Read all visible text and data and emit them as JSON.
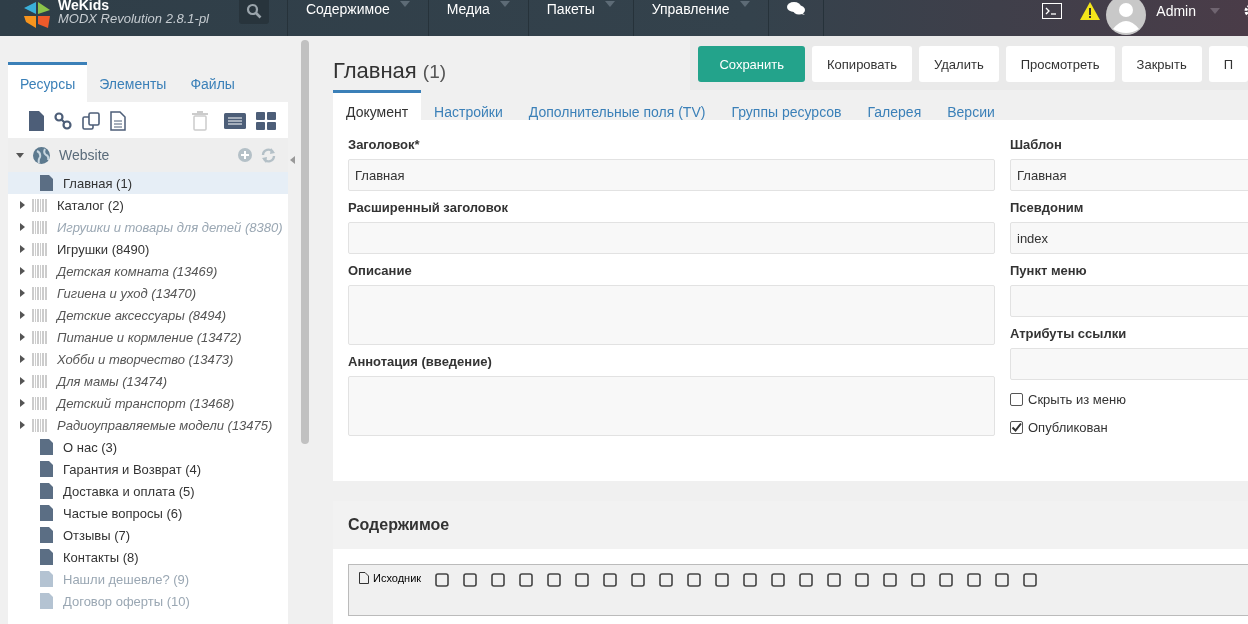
{
  "header": {
    "brand": "WeKids",
    "version": "MODX Revolution 2.8.1-pl",
    "menu": [
      {
        "label": "Содержимое"
      },
      {
        "label": "Медиа"
      },
      {
        "label": "Пакеты"
      },
      {
        "label": "Управление"
      }
    ],
    "user": "Admin"
  },
  "sidebar": {
    "tabs": [
      {
        "label": "Ресурсы",
        "selected": true
      },
      {
        "label": "Элементы",
        "selected": false
      },
      {
        "label": "Файлы",
        "selected": false
      }
    ],
    "context": {
      "label": "Website",
      "expanded": true
    },
    "items": [
      {
        "label": "Главная (1)",
        "kind": "page",
        "hidden": false,
        "published": true,
        "selected": true
      },
      {
        "label": "Каталог (2)",
        "kind": "folder",
        "hidden": false,
        "published": true,
        "selected": false
      },
      {
        "label": "Игрушки и товары для детей (8380)",
        "kind": "folder",
        "hidden": true,
        "published": false,
        "selected": false
      },
      {
        "label": "Игрушки (8490)",
        "kind": "folder",
        "hidden": false,
        "published": true,
        "selected": false
      },
      {
        "label": "Детская комната (13469)",
        "kind": "folder",
        "hidden": true,
        "published": true,
        "selected": false
      },
      {
        "label": "Гигиена и уход (13470)",
        "kind": "folder",
        "hidden": true,
        "published": true,
        "selected": false
      },
      {
        "label": "Детские аксессуары (8494)",
        "kind": "folder",
        "hidden": true,
        "published": true,
        "selected": false
      },
      {
        "label": "Питание и кормление (13472)",
        "kind": "folder",
        "hidden": true,
        "published": true,
        "selected": false
      },
      {
        "label": "Хобби и творчество (13473)",
        "kind": "folder",
        "hidden": true,
        "published": true,
        "selected": false
      },
      {
        "label": "Для мамы (13474)",
        "kind": "folder",
        "hidden": true,
        "published": true,
        "selected": false
      },
      {
        "label": "Детский транспорт (13468)",
        "kind": "folder",
        "hidden": true,
        "published": true,
        "selected": false
      },
      {
        "label": "Радиоуправляемые модели (13475)",
        "kind": "folder",
        "hidden": true,
        "published": true,
        "selected": false
      },
      {
        "label": "О нас (3)",
        "kind": "page",
        "hidden": false,
        "published": true,
        "selected": false
      },
      {
        "label": "Гарантия и Возврат (4)",
        "kind": "page",
        "hidden": false,
        "published": true,
        "selected": false
      },
      {
        "label": "Доставка и оплата (5)",
        "kind": "page",
        "hidden": false,
        "published": true,
        "selected": false
      },
      {
        "label": "Частые вопросы (6)",
        "kind": "page",
        "hidden": false,
        "published": true,
        "selected": false
      },
      {
        "label": "Отзывы (7)",
        "kind": "page",
        "hidden": false,
        "published": true,
        "selected": false
      },
      {
        "label": "Контакты (8)",
        "kind": "page",
        "hidden": false,
        "published": true,
        "selected": false
      },
      {
        "label": "Нашли дешевле? (9)",
        "kind": "page",
        "hidden": false,
        "published": false,
        "selected": false
      },
      {
        "label": "Договор оферты (10)",
        "kind": "page",
        "hidden": false,
        "published": false,
        "selected": false
      }
    ]
  },
  "page": {
    "title": "Главная",
    "id": "(1)",
    "actions": [
      {
        "label": "Сохранить",
        "kind": "primary"
      },
      {
        "label": "Копировать",
        "kind": "default"
      },
      {
        "label": "Удалить",
        "kind": "default"
      },
      {
        "label": "Просмотреть",
        "kind": "default"
      },
      {
        "label": "Закрыть",
        "kind": "default"
      },
      {
        "label": "П",
        "kind": "default"
      }
    ],
    "tabs": [
      {
        "label": "Документ",
        "selected": true
      },
      {
        "label": "Настройки",
        "selected": false
      },
      {
        "label": "Дополнительные поля (TV)",
        "selected": false
      },
      {
        "label": "Группы ресурсов",
        "selected": false
      },
      {
        "label": "Галерея",
        "selected": false
      },
      {
        "label": "Версии",
        "selected": false
      }
    ],
    "left_fields": [
      {
        "label": "Заголовок*",
        "value": "Главная",
        "kind": "input"
      },
      {
        "label": "Расширенный заголовок",
        "kind": "input"
      },
      {
        "label": "Описание",
        "kind": "textarea"
      },
      {
        "label": "Аннотация (введение)",
        "kind": "textarea"
      }
    ],
    "right_fields": [
      {
        "label": "Шаблон",
        "value": "Главная"
      },
      {
        "label": "Псевдоним",
        "value": "index"
      },
      {
        "label": "Пункт меню"
      },
      {
        "label": "Атрибуты ссылки"
      }
    ],
    "checkboxes": [
      {
        "label": "Скрыть из меню",
        "checked": false
      },
      {
        "label": "Опубликован",
        "checked": true
      }
    ],
    "content": {
      "title": "Содержимое",
      "source_button": "Исходник"
    }
  }
}
